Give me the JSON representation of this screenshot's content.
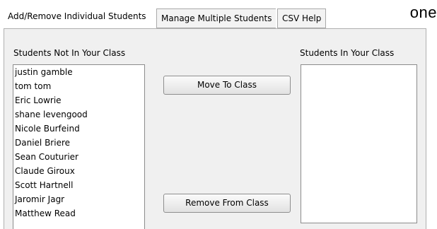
{
  "tabs": [
    {
      "label": "Add/Remove Individual Students",
      "active": true
    },
    {
      "label": "Manage Multiple Students",
      "active": false
    },
    {
      "label": "CSV Help",
      "active": false
    }
  ],
  "overlay_text": "one",
  "left_panel": {
    "title": "Students Not In Your Class",
    "students": [
      "justin gamble",
      "tom tom",
      "Eric Lowrie",
      "shane levengood",
      "Nicole Burfeind",
      "Daniel Briere",
      "Sean Couturier",
      "Claude Giroux",
      "Scott Hartnell",
      "Jaromir Jagr",
      "Matthew Read"
    ]
  },
  "right_panel": {
    "title": "Students In Your Class",
    "students": []
  },
  "buttons": {
    "move_label": "Move To Class",
    "remove_label": "Remove From Class"
  }
}
